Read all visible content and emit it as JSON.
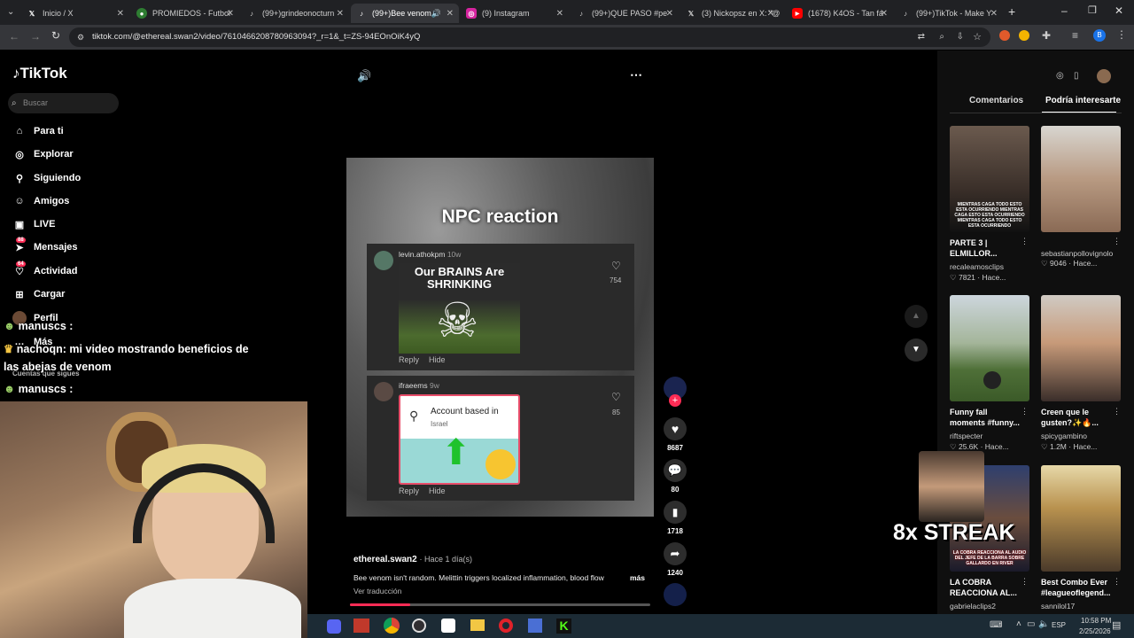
{
  "browser": {
    "tabs": [
      {
        "label": "Inicio / X",
        "icon": "x-icon"
      },
      {
        "label": "PROMIEDOS - Futbol",
        "icon": "soccer-icon"
      },
      {
        "label": "(99+)grindeonocturn",
        "icon": "tiktok-icon"
      },
      {
        "label": "(99+)Bee venom",
        "icon": "tiktok-icon"
      },
      {
        "label": "(9) Instagram",
        "icon": "instagram-icon"
      },
      {
        "label": "(99+)QUE PASO #pe",
        "icon": "tiktok-icon"
      },
      {
        "label": "(3) Nickopsz en X: \"@",
        "icon": "x-icon"
      },
      {
        "label": "(1678) K4OS - Tan fá",
        "icon": "youtube-icon"
      },
      {
        "label": "(99+)TikTok - Make Y",
        "icon": "tiktok-icon"
      }
    ],
    "url": "tiktok.com/@ethereal.swan2/video/7610466208780963094?_r=1&_t=ZS-94EOnOiK4yQ"
  },
  "sidebar": {
    "logo": "TikTok",
    "search_placeholder": "Buscar",
    "items": [
      {
        "label": "Para ti",
        "icon": "home-icon"
      },
      {
        "label": "Explorar",
        "icon": "compass-icon"
      },
      {
        "label": "Siguiendo",
        "icon": "user-follow-icon"
      },
      {
        "label": "Amigos",
        "icon": "friends-icon"
      },
      {
        "label": "LIVE",
        "icon": "live-icon"
      },
      {
        "label": "Mensajes",
        "icon": "messages-icon",
        "badge": "88"
      },
      {
        "label": "Actividad",
        "icon": "activity-icon",
        "badge": "64"
      },
      {
        "label": "Cargar",
        "icon": "upload-icon"
      },
      {
        "label": "Perfil",
        "icon": "avatar-icon"
      },
      {
        "label": "Más",
        "icon": "more-icon"
      }
    ],
    "following_label": "Cuentas que sigues"
  },
  "overlay_chat": [
    {
      "user": "manuscs :",
      "text": ""
    },
    {
      "user": "nachoqn",
      "text": ": mi video mostrando beneficios de"
    },
    {
      "user": "",
      "text": "las abejas de venom"
    },
    {
      "user": "manuscs :",
      "text": ""
    }
  ],
  "video": {
    "title": "NPC reaction",
    "comments": [
      {
        "user": "levin.athokpm",
        "time": "10w",
        "image_text": "Our BRAINS Are SHRINKING",
        "likes": "754",
        "reply": "Reply",
        "hide": "Hide"
      },
      {
        "user": "ifraeems",
        "time": "9w",
        "image_text": "Account based in",
        "image_subtext": "Israel",
        "likes": "85",
        "reply": "Reply",
        "hide": "Hide"
      }
    ],
    "author": "ethereal.swan2",
    "posted": "· Hace 1 día(s)",
    "description": "Bee venom isn't random. Melittin triggers localized inflammation, blood flow",
    "more": "más",
    "translate": "Ver traducción",
    "progress": 0.2
  },
  "actions": {
    "likes": "8687",
    "comments": "80",
    "saves": "1718",
    "shares": "1240"
  },
  "right_panel": {
    "tabs": [
      "Comentarios",
      "Podría interesarte"
    ],
    "items": [
      {
        "title": "PARTE 3 | ELMILLOR...",
        "author": "recaleamosclips",
        "likes": "7821",
        "ago": "Hace..."
      },
      {
        "title": "",
        "author": "sebastianpollovignolo",
        "likes": "9046",
        "ago": "Hace..."
      },
      {
        "title": "Funny fall moments #funny...",
        "author": "riftspecter",
        "likes": "25.6K",
        "ago": "Hace..."
      },
      {
        "title": "Creen que le gusten?✨🔥...",
        "author": "spicygambino",
        "likes": "1.2M",
        "ago": "Hace..."
      },
      {
        "title": "LA COBRA REACCIONA AL...",
        "author": "gabrielaclips2",
        "likes": "",
        "ago": ""
      },
      {
        "title": "Best Combo Ever #leagueoflegend...",
        "author": "sannilol17",
        "likes": "",
        "ago": ""
      }
    ],
    "thumb1_caption": "MIENTRAS CAGA TODO ESTO ESTA OCURRIENDO MIENTRAS CAGA ESTO ESTA OCURRIENDO MIENTRAS CAGA TODO ESTO ESTA OCURRIENDO",
    "thumb5_caption": "LA COBRA REACCIONA AL AUDIO DEL JEFE DE LA BARRA SOBRE GALLARDO EN RIVER"
  },
  "stream_overlay": {
    "streak": "8x STREAK"
  },
  "taskbar": {
    "lang": "ESP",
    "time": "10:58 PM",
    "date": "2/25/2026"
  }
}
